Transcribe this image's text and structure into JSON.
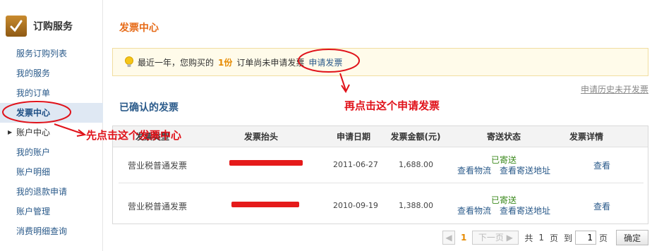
{
  "sidebar": {
    "title": "订购服务",
    "items": [
      {
        "label": "服务订购列表"
      },
      {
        "label": "我的服务"
      },
      {
        "label": "我的订单"
      },
      {
        "label": "发票中心"
      },
      {
        "label": "账户中心"
      },
      {
        "label": "我的账户"
      },
      {
        "label": "账户明细"
      },
      {
        "label": "我的退款申请"
      },
      {
        "label": "账户管理"
      },
      {
        "label": "消费明细查询"
      }
    ]
  },
  "main": {
    "title": "发票中心",
    "notice": {
      "prefix": "最近一年，您购买的",
      "count": "1份",
      "suffix": "订单尚未申请发票",
      "link": "申请发票"
    },
    "history_link": "申请历史未开发票",
    "section_title": "已确认的发票",
    "table": {
      "headers": [
        "发票类型",
        "发票抬头",
        "申请日期",
        "发票金额(元)",
        "寄送状态",
        "发票详情"
      ],
      "rows": [
        {
          "type": "营业税普通发票",
          "date": "2011-06-27",
          "amount": "1,688.00",
          "status": "已寄送",
          "link_logistics": "查看物流",
          "link_address": "查看寄送地址",
          "detail": "查看"
        },
        {
          "type": "营业税普通发票",
          "date": "2010-09-19",
          "amount": "1,388.00",
          "status": "已寄送",
          "link_logistics": "查看物流",
          "link_address": "查看寄送地址",
          "detail": "查看"
        }
      ]
    },
    "pager": {
      "current": "1",
      "next": "下一页",
      "total_prefix": "共",
      "total": "1",
      "page_unit": "页",
      "goto_prefix": "到",
      "goto_value": "1",
      "goto_unit": "页",
      "confirm": "确定"
    }
  },
  "annotations": {
    "step1": "先点击这个发票中心",
    "step2": "再点击这个申请发票"
  },
  "colors": {
    "accent": "#e66a17",
    "link": "#2a5a8a",
    "annotation": "#e0121a",
    "sent": "#3c8a1e"
  }
}
